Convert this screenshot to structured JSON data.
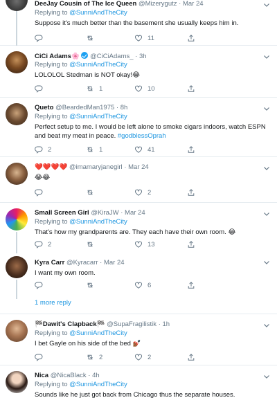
{
  "tweets": [
    {
      "name": "DeeJay Cousin of The Ice Queen",
      "handle": "@Mizerygutz",
      "time": "Mar 24",
      "replying_label": "Replying to",
      "replying_to": "@SunniAndTheCity",
      "text": "Suppose it's much better than the basement she usually keeps him in.",
      "likes": "11"
    },
    {
      "name": "CiCi Adams",
      "name_emoji": "🌸",
      "handle": "@CiCiAdams_",
      "time": "3h",
      "replying_label": "Replying to",
      "replying_to": "@SunniAndTheCity",
      "text": "LOLOLOL Stedman is NOT okay!",
      "text_emoji": "😂",
      "retweets": "1",
      "likes": "10"
    },
    {
      "name": "Queto",
      "handle": "@BeardedMan1975",
      "time": "8h",
      "replying_label": "Replying to",
      "replying_to": "@SunniAndTheCity",
      "text": "Perfect setup to me. I would be left alone to smoke cigars indoors, watch ESPN and beat my meat in peace.",
      "hashtag": "#godblessOprah",
      "replies": "2",
      "retweets": "1",
      "likes": "41"
    },
    {
      "name": "❤️❤️❤️❤️",
      "handle": "@imamaryjanegirl",
      "time": "Mar 24",
      "text": "😂😂",
      "likes": "2"
    },
    {
      "name": "Small Screen Girl",
      "handle": "@KiraJW",
      "time": "Mar 24",
      "replying_label": "Replying to",
      "replying_to": "@SunniAndTheCity",
      "text": "That's how my grandparents are. They each have their own room.",
      "text_emoji": "😂",
      "replies": "2",
      "likes": "13"
    },
    {
      "name": "Kyra Carr",
      "handle": "@Kyracarr",
      "time": "Mar 24",
      "text": "I want my own room.",
      "likes": "6"
    },
    {
      "more_replies": "1 more reply"
    },
    {
      "name": "Dawit's Clapback",
      "name_prefix": "🏁",
      "name_suffix": "🏁",
      "handle": "@SupaFragilistik",
      "time": "1h",
      "replying_label": "Replying to",
      "replying_to": "@SunniAndTheCity",
      "text": "I bet Gayle on his side of the bed",
      "text_emoji": "💅🏾",
      "retweets": "2",
      "likes": "2"
    },
    {
      "name": "Nica",
      "handle": "@NicaBlack",
      "time": "4h",
      "replying_label": "Replying to",
      "replying_to": "@SunniAndTheCity",
      "text": "Sounds like he just got back from Chicago thus the separate houses."
    }
  ],
  "separator": "·",
  "colors": {
    "link": "#1b95e0",
    "muted": "#657786",
    "border": "#e6ecf0",
    "verified": "#1da1f2"
  },
  "icons": [
    "reply-icon",
    "retweet-icon",
    "like-icon",
    "share-icon",
    "chevron-down-icon",
    "verified-badge-icon"
  ]
}
